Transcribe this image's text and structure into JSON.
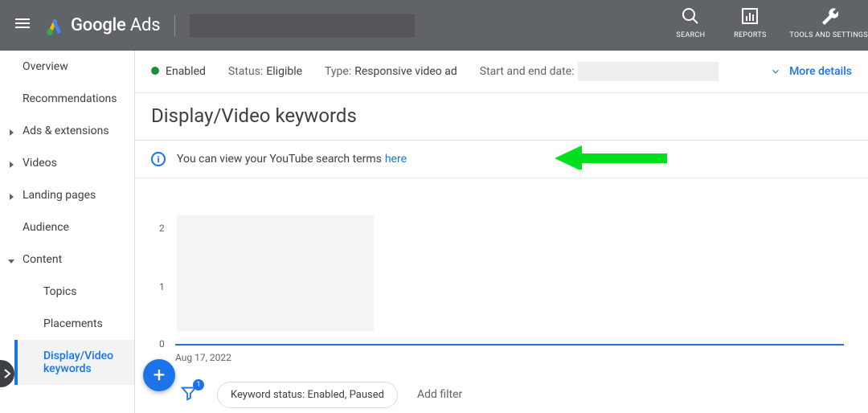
{
  "header": {
    "brand_bold": "Google",
    "brand_light": "Ads",
    "actions": {
      "search": "SEARCH",
      "reports": "REPORTS",
      "tools": "TOOLS AND SETTINGS"
    }
  },
  "sidebar": {
    "overview": "Overview",
    "recommendations": "Recommendations",
    "ads_ext": "Ads & extensions",
    "videos": "Videos",
    "landing": "Landing pages",
    "audience": "Audience",
    "content": "Content",
    "topics": "Topics",
    "placements": "Placements",
    "dvk": "Display/Video keywords"
  },
  "infobar": {
    "enabled": "Enabled",
    "status_label": "Status:",
    "status_value": "Eligible",
    "type_label": "Type:",
    "type_value": "Responsive video ad",
    "date_label": "Start and end date:",
    "more_details": "More details"
  },
  "page_title": "Display/Video keywords",
  "notice": {
    "text": "You can view your YouTube search terms",
    "link": "here"
  },
  "chart_data": {
    "type": "line",
    "yticks": [
      2,
      1,
      0
    ],
    "xstart": "Aug 17, 2022",
    "series": [
      {
        "name": "value",
        "values": []
      }
    ],
    "ylim": [
      0,
      2
    ]
  },
  "filters": {
    "badge": "1",
    "chip": "Keyword status: Enabled, Paused",
    "add": "Add filter"
  }
}
